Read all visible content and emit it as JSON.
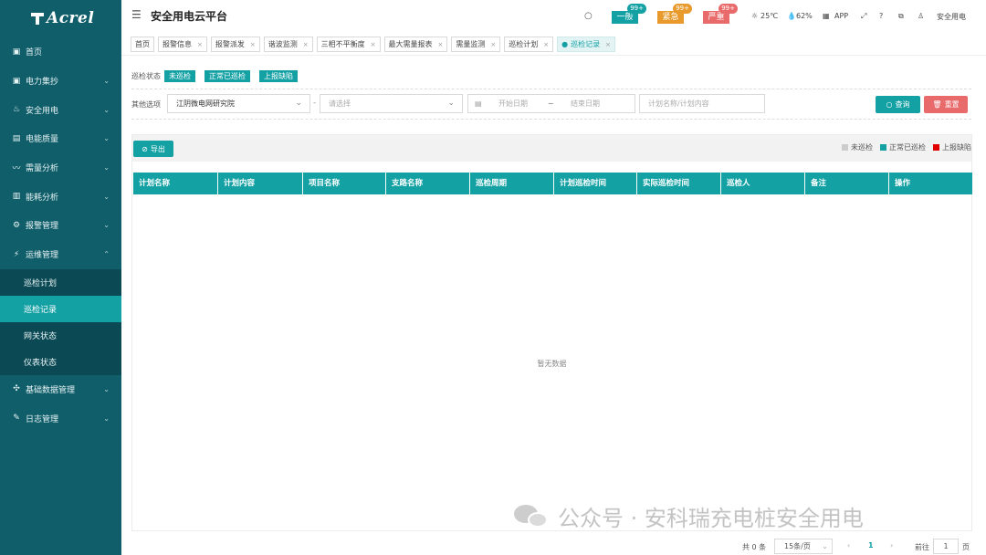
{
  "app": {
    "logo_text": "Acrel",
    "page_title": "安全用电云平台"
  },
  "sidebar": {
    "items": [
      {
        "label": "首页",
        "icon": "monitor-icon",
        "glyph": "▣"
      },
      {
        "label": "电力集抄",
        "icon": "screen-icon",
        "glyph": "▣"
      },
      {
        "label": "安全用电",
        "icon": "flame-icon",
        "glyph": "♨"
      },
      {
        "label": "电能质量",
        "icon": "display-icon",
        "glyph": "▤"
      },
      {
        "label": "需量分析",
        "icon": "trend-icon",
        "glyph": "〰"
      },
      {
        "label": "能耗分析",
        "icon": "bar-chart-icon",
        "glyph": "▥"
      },
      {
        "label": "报警管理",
        "icon": "alarm-icon",
        "glyph": "⚙"
      },
      {
        "label": "运维管理",
        "icon": "ops-icon",
        "glyph": "⚡"
      }
    ],
    "sub_items": [
      {
        "label": "巡检计划"
      },
      {
        "label": "巡检记录"
      },
      {
        "label": "网关状态"
      },
      {
        "label": "仪表状态"
      }
    ],
    "bottom_items": [
      {
        "label": "基础数据管理",
        "icon": "data-icon",
        "glyph": "✣"
      },
      {
        "label": "日志管理",
        "icon": "log-icon",
        "glyph": "✎"
      }
    ]
  },
  "header": {
    "alarms": [
      {
        "label": "一般",
        "count": "99+",
        "color": "#14a1a4"
      },
      {
        "label": "紧急",
        "count": "99+",
        "color": "#e89a2c"
      },
      {
        "label": "严重",
        "count": "99+",
        "color": "#e86a6a"
      }
    ],
    "temperature": "25℃",
    "humidity": "62%",
    "app_label": "APP",
    "user_label": "安全用电"
  },
  "tabs": [
    {
      "label": "首页"
    },
    {
      "label": "报警信息"
    },
    {
      "label": "报警派发"
    },
    {
      "label": "谐波监测"
    },
    {
      "label": "三相不平衡度"
    },
    {
      "label": "最大需量报表"
    },
    {
      "label": "需量监测"
    },
    {
      "label": "巡检计划"
    },
    {
      "label": "巡检记录"
    }
  ],
  "filters": {
    "status_label": "巡检状态",
    "status_options": [
      "未巡检",
      "正常已巡检",
      "上报缺陷"
    ],
    "other_label": "其他选项",
    "org_value": "江阴微电网研究院",
    "select_placeholder": "请选择",
    "start_placeholder": "开始日期",
    "date_sep": "~",
    "end_placeholder": "结束日期",
    "keyword_placeholder": "计划名称/计划内容",
    "query_label": "查询",
    "reset_label": "重置"
  },
  "toolbar": {
    "export_label": "导出",
    "legend": [
      {
        "label": "未巡检",
        "color": "#cccccc"
      },
      {
        "label": "正常已巡检",
        "color": "#14a1a4"
      },
      {
        "label": "上报缺陷",
        "color": "#e00000"
      }
    ]
  },
  "table": {
    "columns": [
      "计划名称",
      "计划内容",
      "项目名称",
      "支路名称",
      "巡检周期",
      "计划巡检时间",
      "实际巡检时间",
      "巡检人",
      "备注",
      "操作"
    ],
    "empty_text": "暂无数据"
  },
  "pagination": {
    "total": "共 0 条",
    "page_size": "15条/页",
    "current_page": "1",
    "goto_label": "前往",
    "goto_value": "1",
    "page_unit": "页"
  },
  "watermark": {
    "text": "公众号 · 安科瑞充电桩安全用电"
  }
}
